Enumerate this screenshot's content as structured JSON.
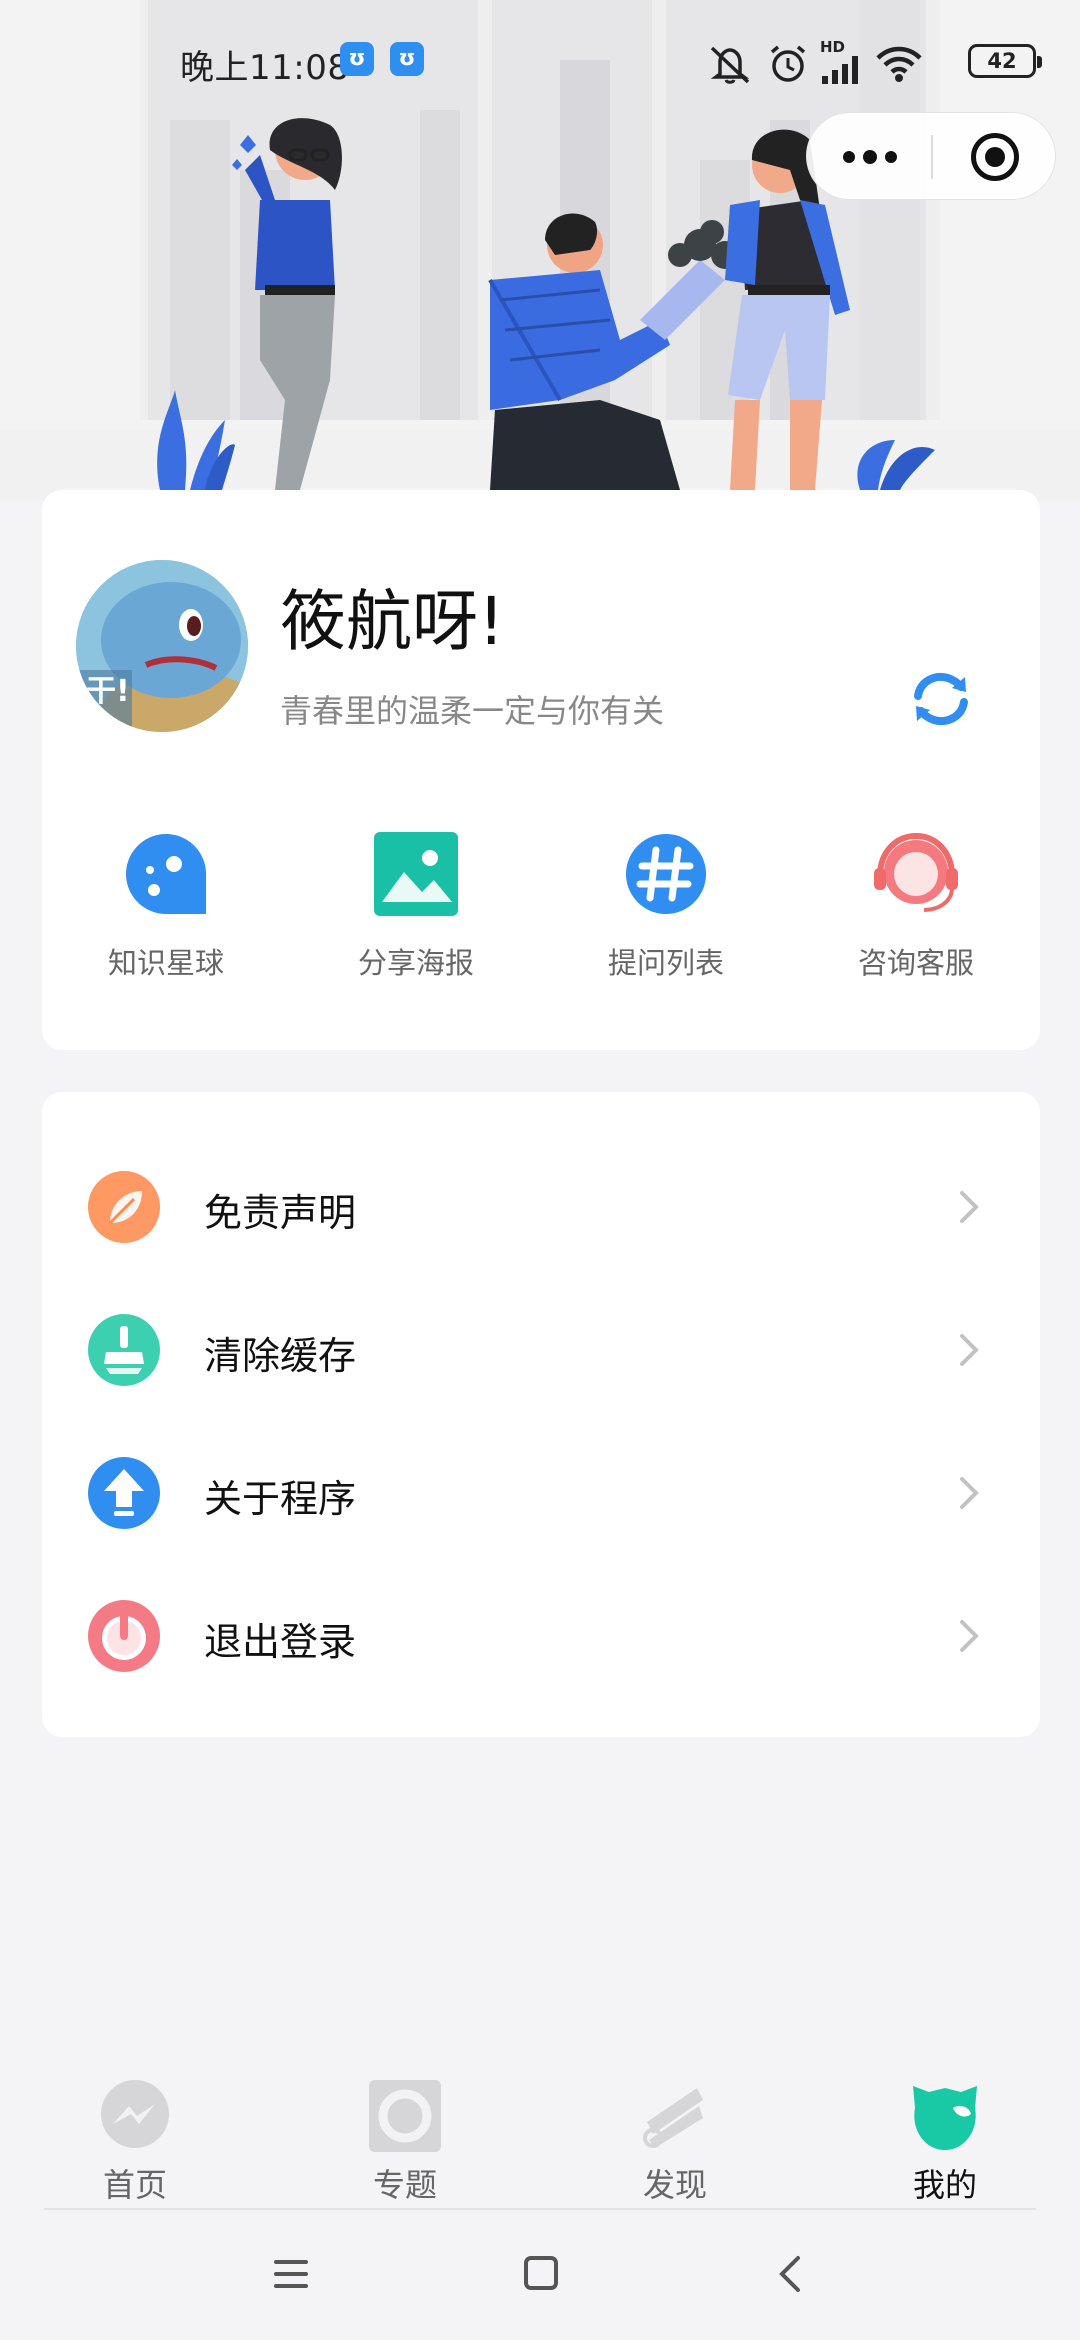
{
  "status_bar": {
    "time": "晚上11:08",
    "app_badges": [
      "ʊ",
      "ʊ"
    ],
    "network": "HD",
    "battery": "42"
  },
  "capsule": {
    "more_icon": "more-dots-icon",
    "close_icon": "target-close-icon"
  },
  "profile": {
    "nickname": "筱航呀!",
    "signature": "青春里的温柔一定与你有关",
    "avatar_text": "干!"
  },
  "quick_actions": [
    {
      "label": "知识星球",
      "icon": "planet-icon",
      "color": "#2f8ef0"
    },
    {
      "label": "分享海报",
      "icon": "image-icon",
      "color": "#19c0a6"
    },
    {
      "label": "提问列表",
      "icon": "hash-icon",
      "color": "#2f8ef0"
    },
    {
      "label": "咨询客服",
      "icon": "headset-icon",
      "color": "#f06a6a"
    }
  ],
  "menu": [
    {
      "label": "免责声明",
      "icon": "leaf-icon",
      "color": "#ff8a4c"
    },
    {
      "label": "清除缓存",
      "icon": "broom-icon",
      "color": "#3cd0b0"
    },
    {
      "label": "关于程序",
      "icon": "upload-arrow-icon",
      "color": "#2f8ef0"
    },
    {
      "label": "退出登录",
      "icon": "power-icon",
      "color": "#f47a86"
    }
  ],
  "tabs": [
    {
      "label": "首页",
      "icon": "messenger-icon",
      "active": false
    },
    {
      "label": "专题",
      "icon": "topic-icon",
      "active": false
    },
    {
      "label": "发现",
      "icon": "discover-icon",
      "active": false
    },
    {
      "label": "我的",
      "icon": "profile-cat-icon",
      "active": true
    }
  ],
  "colors": {
    "accent": "#19c9a6",
    "primary_blue": "#2f8ef0",
    "background": "#f4f4f6"
  }
}
